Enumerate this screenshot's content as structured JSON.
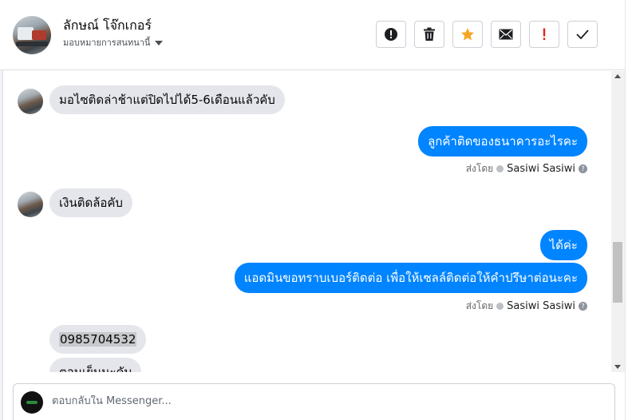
{
  "header": {
    "contact_name": "ลักษณ์ โจ๊กเกอร์",
    "assign_label": "มอบหมายการสนทนานี้",
    "actions": [
      {
        "name": "spam-button",
        "icon": "alert-circle-icon",
        "glyph": "!"
      },
      {
        "name": "delete-button",
        "icon": "trash-icon",
        "glyph": "🗑"
      },
      {
        "name": "star-button",
        "icon": "star-icon",
        "glyph": "★",
        "color": "#f5a623"
      },
      {
        "name": "mark-unread-button",
        "icon": "envelope-icon",
        "glyph": "✉"
      },
      {
        "name": "follow-up-button",
        "icon": "exclamation-icon",
        "glyph": "!",
        "color": "#e02020"
      },
      {
        "name": "mark-done-button",
        "icon": "checkmark-icon",
        "glyph": "✓"
      }
    ]
  },
  "messages": [
    {
      "direction": "in",
      "text": "มอไซติดล่าช้าแต่ปิดไปได้5-6เดือนแล้วคับ"
    },
    {
      "direction": "out",
      "text": "ลูกค้าติดของธนาคารอะไรคะ"
    },
    {
      "direction": "sent_by",
      "prefix": "ส่งโดย",
      "sender": "Sasiwi Sasiwi"
    },
    {
      "direction": "in",
      "text": "เงินติดล้อคับ"
    },
    {
      "direction": "out",
      "text": "ได้ค่ะ"
    },
    {
      "direction": "out",
      "text": "แอดมินขอทราบเบอร์ติดต่อ เพื่อให้เซลล์ติดต่อให้คำปรึษาต่อนะคะ"
    },
    {
      "direction": "sent_by",
      "prefix": "ส่งโดย",
      "sender": "Sasiwi Sasiwi"
    },
    {
      "direction": "in",
      "text": "0985704532"
    },
    {
      "direction": "in",
      "text": "ตอนเย็นนะคับ"
    }
  ],
  "composer": {
    "placeholder": "ตอบกลับใน Messenger..."
  },
  "colors": {
    "outgoing_bubble": "#0084ff",
    "incoming_bubble": "#e4e6eb",
    "star": "#f5a623",
    "follow_up": "#e02020"
  }
}
